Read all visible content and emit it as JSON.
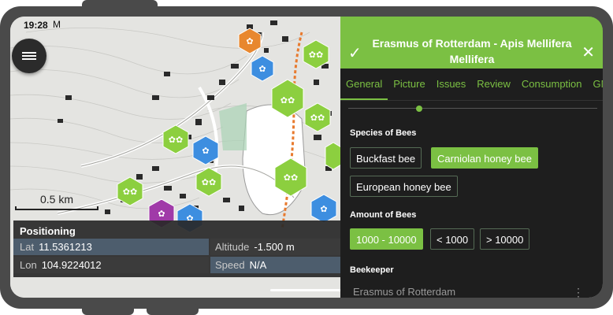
{
  "status": {
    "time": "19:28",
    "mail_icon": "M"
  },
  "map": {
    "scale_label": "0.5 km"
  },
  "positioning": {
    "title": "Positioning",
    "lat_label": "Lat",
    "lat_value": "11.5361213",
    "lon_label": "Lon",
    "lon_value": "104.9224012",
    "alt_label": "Altitude",
    "alt_value": "-1.500 m",
    "speed_label": "Speed",
    "speed_value": "N/A"
  },
  "panel": {
    "title": "Erasmus of Rotterdam - Apis Mellifera Mellifera",
    "tabs": [
      "General",
      "Picture",
      "Issues",
      "Review",
      "Consumption",
      "GNSS"
    ],
    "species_label": "Species of Bees",
    "species": [
      "Buckfast bee",
      "Carniolan honey bee",
      "European honey bee"
    ],
    "species_selected": "Carniolan honey bee",
    "amount_label": "Amount of Bees",
    "amounts": [
      "1000 - 10000",
      "< 1000",
      "> 10000"
    ],
    "amount_selected": "1000 - 10000",
    "beekeeper_label": "Beekeeper",
    "beekeeper_value": "Erasmus of Rotterdam"
  },
  "colors": {
    "accent": "#7bc043",
    "hive_green": "#8ccf3f",
    "hive_blue": "#3d8ee0",
    "hive_purple": "#a03aa8",
    "hive_orange": "#e8872e"
  }
}
